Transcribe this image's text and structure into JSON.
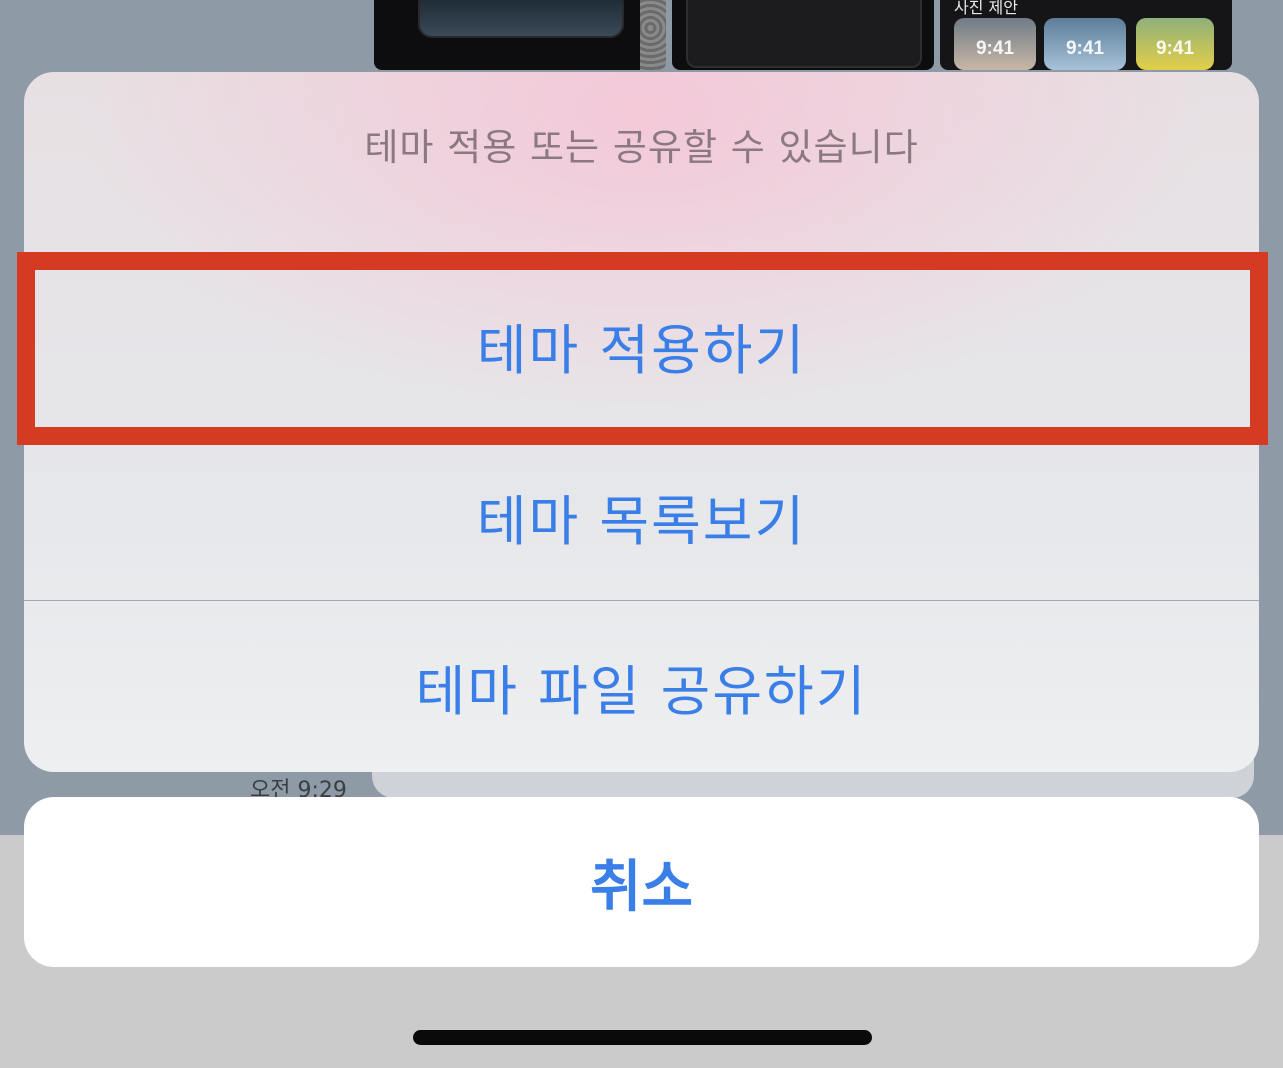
{
  "background": {
    "photo_suggestions_caption": "사진 제안",
    "lock_times": [
      "9:41",
      "9:41",
      "9:41"
    ],
    "timestamp": "오전 9:29"
  },
  "action_sheet": {
    "title": "테마 적용 또는 공유할 수 있습니다",
    "actions": [
      {
        "label": "테마 적용하기",
        "highlighted": true
      },
      {
        "label": "테마 목록보기",
        "highlighted": false
      },
      {
        "label": "테마 파일 공유하기",
        "highlighted": false
      }
    ],
    "cancel_label": "취소"
  },
  "colors": {
    "action_text": "#3a7ee8",
    "highlight_border": "#d53a22",
    "title_text": "#8a7882"
  }
}
